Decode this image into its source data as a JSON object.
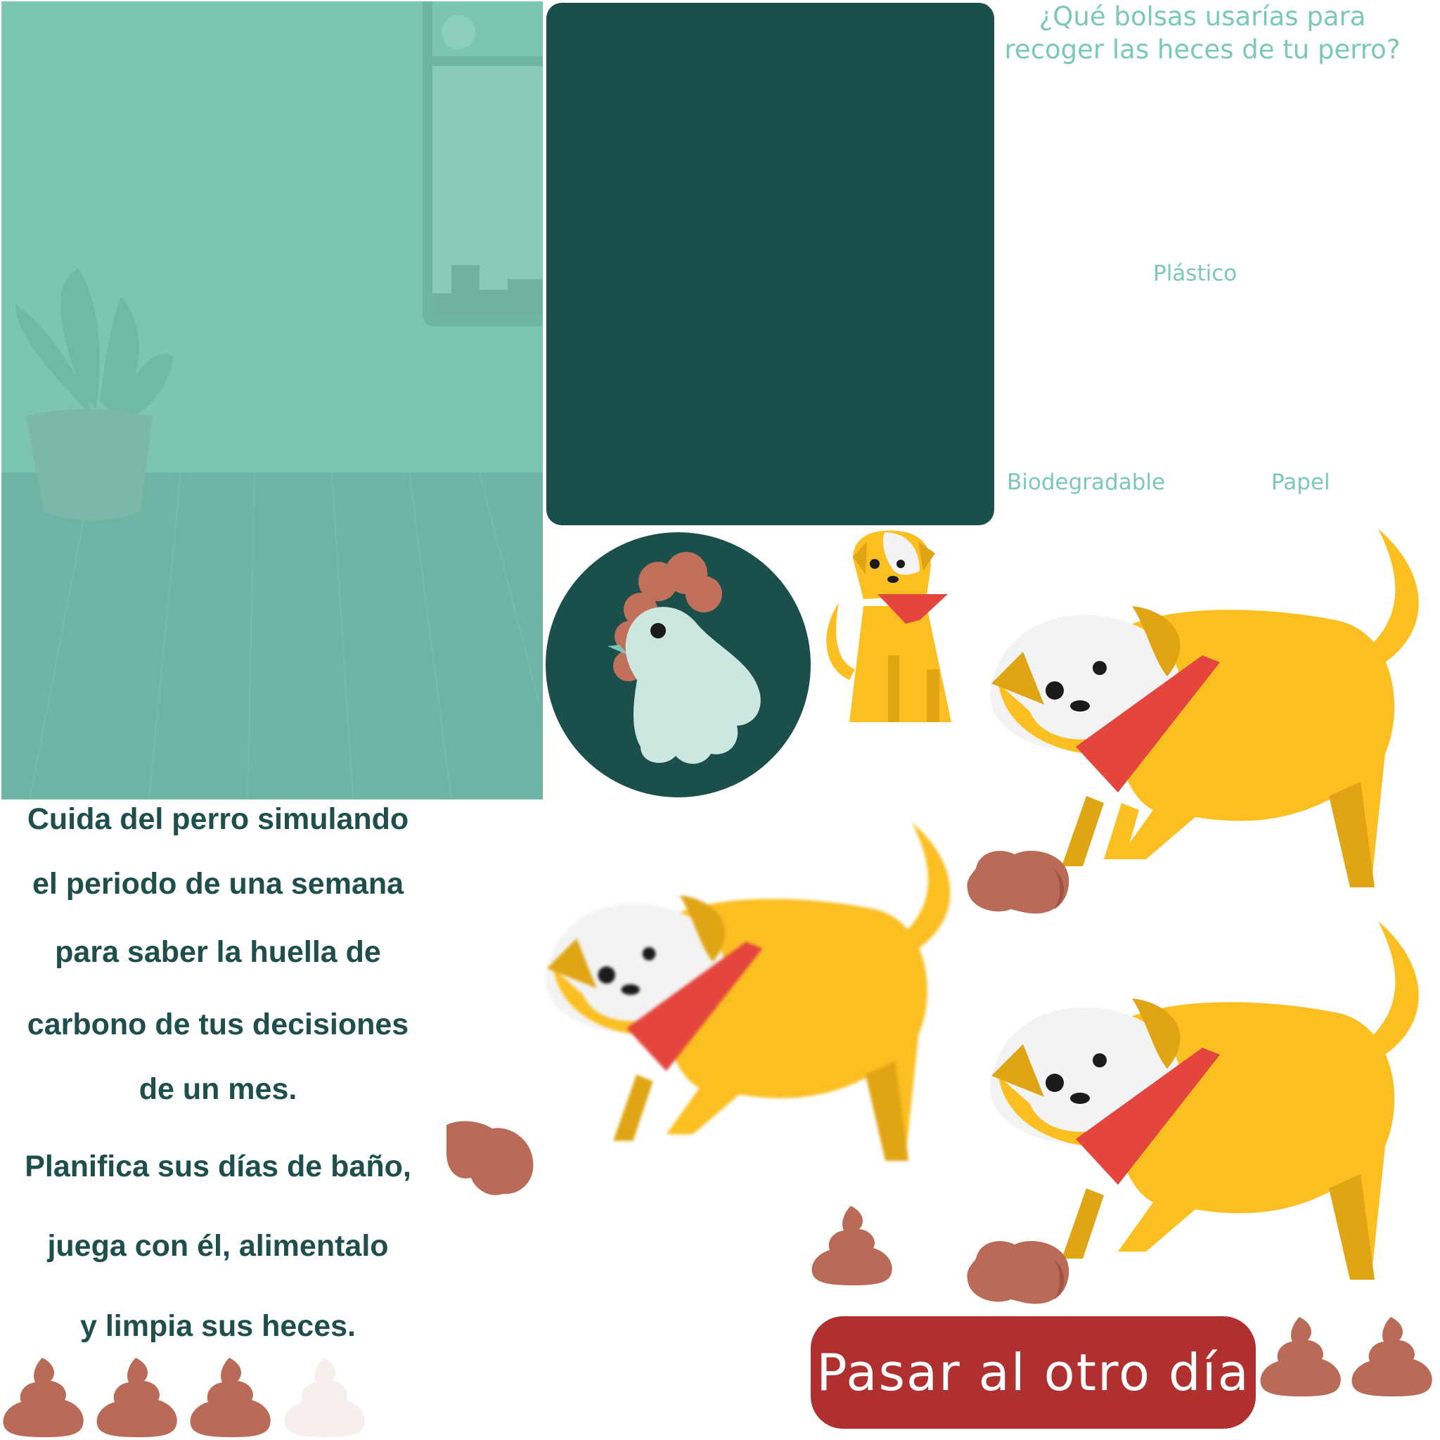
{
  "colors": {
    "room_wall": "#7dc5b3",
    "room_floor": "#6fb3a4",
    "panel": "#1a4f4c",
    "question_text": "#7ac8b6",
    "intro_text": "#1e4f4c",
    "button": "#b03030",
    "button_text": "#ffffff",
    "dog_body": "#fbbf22",
    "dog_shade": "#e0a514",
    "bandana": "#e4463d",
    "poop": "#b96b58",
    "poop_empty": "#f7efed",
    "chicken_body": "#cbe7e0",
    "chicken_comb": "#c0705b"
  },
  "question": {
    "line1": "¿Qué bolsas usarías para",
    "line2": "recoger las heces de tu perro?"
  },
  "options": {
    "plastic": "Plástico",
    "biodegradable": "Biodegradable",
    "paper": "Papel"
  },
  "intro": {
    "lines": [
      "Cuida del perro simulando",
      "el periodo de una semana",
      "para saber la huella de",
      "carbono de tus decisiones",
      "de un mes.",
      "Planifica sus días de baño,",
      "juega con él, alimentalo",
      "y limpia sus heces."
    ]
  },
  "next_button": {
    "label": "Pasar al otro día"
  },
  "poop_meter": {
    "filled": 3,
    "total": 4
  },
  "icons": {
    "chicken": "chicken-icon",
    "poop": "poop-icon",
    "dog": "dog-icon",
    "plant": "plant-icon"
  }
}
